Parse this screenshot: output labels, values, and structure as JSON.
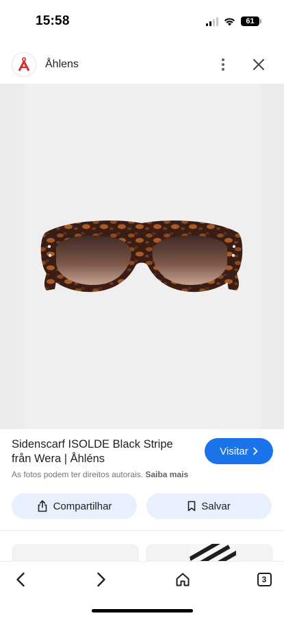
{
  "status_bar": {
    "time": "15:58",
    "battery": "61",
    "icons": [
      "cellular-signal-icon",
      "wifi-icon",
      "battery-icon"
    ]
  },
  "site_header": {
    "name": "Åhlens",
    "logo_letter": "Å",
    "icons": [
      "more-vertical-icon",
      "close-icon"
    ]
  },
  "product": {
    "title": "Sidenscarf ISOLDE Black Stripe från Wera | Åhléns",
    "visit_label": "Visitar",
    "copyright_text": "As fotos podem ter direitos autorais.",
    "learn_more": "Saiba mais"
  },
  "actions": {
    "share_label": "Compartilhar",
    "save_label": "Salvar"
  },
  "browser_nav": {
    "tab_count": "3",
    "icons": [
      "back-icon",
      "forward-icon",
      "home-icon",
      "tabs-icon"
    ]
  },
  "colors": {
    "accent": "#1a73e8",
    "chip_bg": "#e8f0fe",
    "logo_red": "#d62c2c",
    "hero_bg": "#ececec"
  }
}
